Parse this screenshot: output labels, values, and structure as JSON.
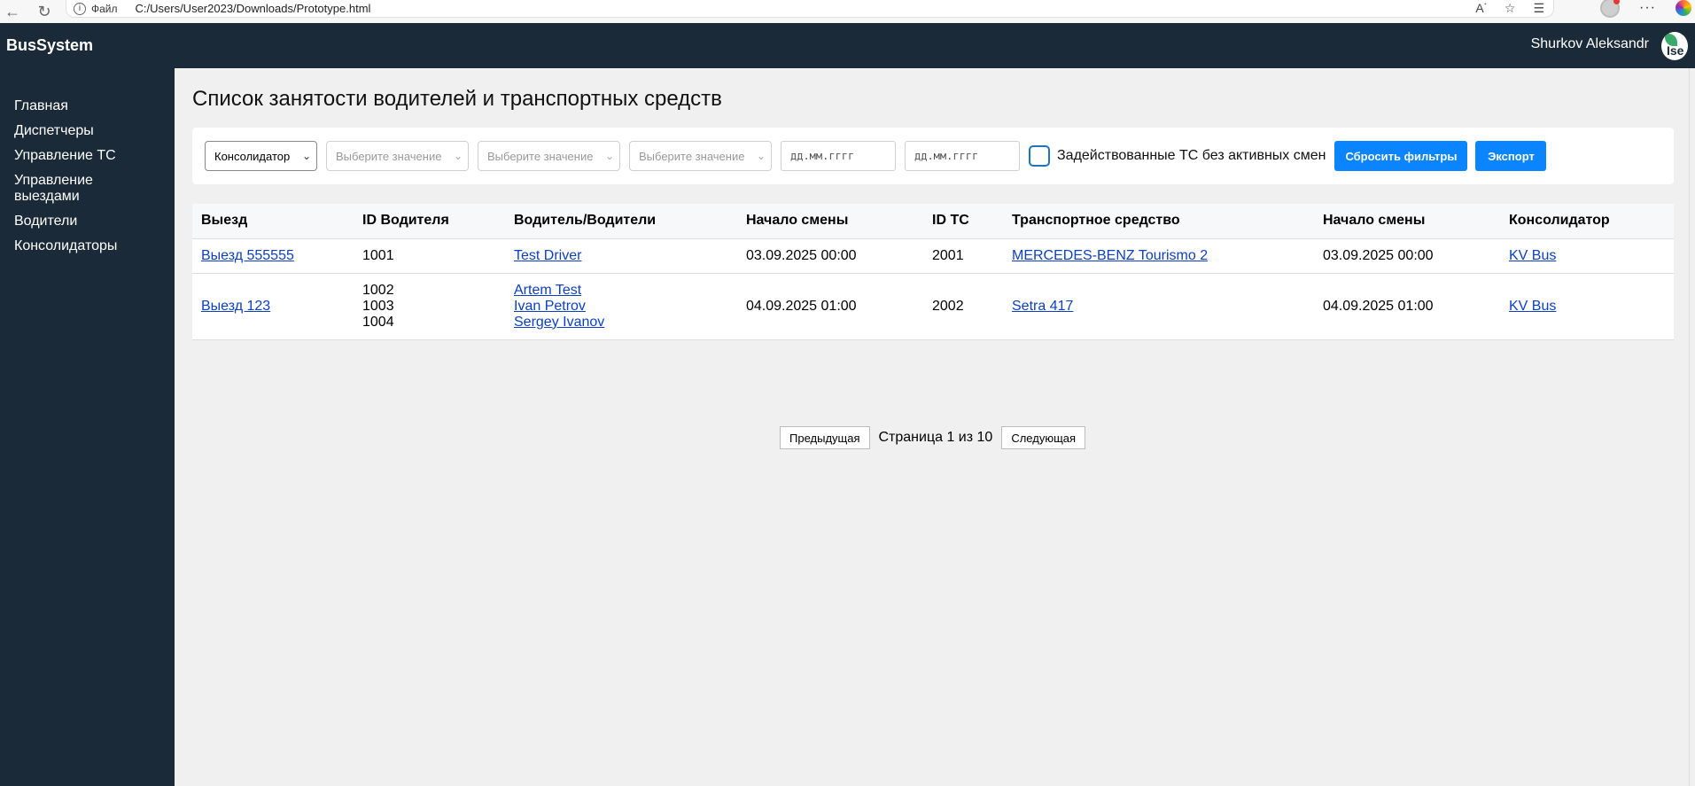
{
  "browser": {
    "protocol_label": "Файл",
    "url": "C:/Users/User2023/Downloads/Prototype.html"
  },
  "app": {
    "brand": "BusSystem",
    "user_name": "Shurkov Aleksandr",
    "avatar_text": "Ise"
  },
  "sidebar": {
    "items": [
      {
        "label": "Главная"
      },
      {
        "label": "Диспетчеры"
      },
      {
        "label": "Управление ТС"
      },
      {
        "label": "Управление выездами"
      },
      {
        "label": "Водители"
      },
      {
        "label": "Консолидаторы"
      }
    ]
  },
  "page": {
    "title": "Список занятости водителей и транспортных средств"
  },
  "filters": {
    "consolidator_select": "Консолидатор",
    "select_placeholder_1": "Выберите значение",
    "select_placeholder_2": "Выберите значение",
    "select_placeholder_3": "Выберите значение",
    "date_from_placeholder": "дд.мм.гггг",
    "date_to_placeholder": "дд.мм.гггг",
    "checkbox_label": "Задействованные ТС без активных смен",
    "reset_label": "Сбросить фильтры",
    "export_label": "Экспорт"
  },
  "table": {
    "headers": [
      "Выезд",
      "ID Водителя",
      "Водитель/Водители",
      "Начало смены",
      "ID ТС",
      "Транспортное средство",
      "Начало смены",
      "Консолидатор"
    ],
    "rows": [
      {
        "trip": "Выезд 555555",
        "driver_ids": [
          "1001"
        ],
        "drivers": [
          "Test Driver"
        ],
        "shift_start": "03.09.2025 00:00",
        "vehicle_id": "2001",
        "vehicle": "MERCEDES-BENZ Tourismo 2",
        "vehicle_shift_start": "03.09.2025 00:00",
        "consolidator": "KV Bus"
      },
      {
        "trip": "Выезд 123",
        "driver_ids": [
          "1002",
          "1003",
          "1004"
        ],
        "drivers": [
          "Artem Test",
          "Ivan Petrov",
          "Sergey Ivanov"
        ],
        "shift_start": "04.09.2025 01:00",
        "vehicle_id": "2002",
        "vehicle": "Setra 417",
        "vehicle_shift_start": "04.09.2025 01:00",
        "consolidator": "KV Bus"
      }
    ]
  },
  "pagination": {
    "prev_label": "Предыдущая",
    "page_text": "Страница 1 из 10",
    "next_label": "Следующая"
  }
}
